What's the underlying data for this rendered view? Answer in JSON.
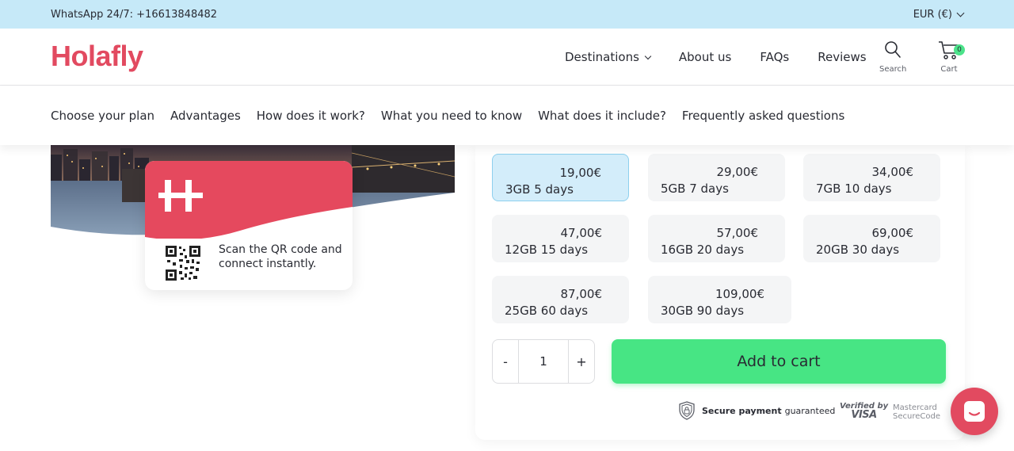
{
  "topbar": {
    "whatsapp": "WhatsApp 24/7: +16613848482",
    "currency": "EUR (€)"
  },
  "header": {
    "logo": "Holafly",
    "nav": [
      "Destinations",
      "About us",
      "FAQs",
      "Reviews"
    ],
    "search_label": "Search",
    "cart_label": "Cart",
    "cart_count": "0"
  },
  "subnav": {
    "items": [
      "Choose your plan",
      "Advantages",
      "How does it work?",
      "What you need to know",
      "What does it include?",
      "Frequently asked questions"
    ]
  },
  "sim_card": {
    "text": "Scan the QR code and connect instantly."
  },
  "plans": [
    {
      "price": "19,00€",
      "name": "3GB 5 days",
      "selected": true
    },
    {
      "price": "29,00€",
      "name": "5GB 7 days",
      "selected": false
    },
    {
      "price": "34,00€",
      "name": "7GB 10 days",
      "selected": false
    },
    {
      "price": "47,00€",
      "name": "12GB 15 days",
      "selected": false
    },
    {
      "price": "57,00€",
      "name": "16GB 20 days",
      "selected": false
    },
    {
      "price": "69,00€",
      "name": "20GB 30 days",
      "selected": false
    },
    {
      "price": "87,00€",
      "name": "25GB 60 days",
      "selected": false
    },
    {
      "price": "109,00€",
      "name": "30GB 90 days",
      "selected": false
    }
  ],
  "quantity": {
    "minus": "-",
    "value": "1",
    "plus": "+"
  },
  "add_to_cart": "Add to cart",
  "security": {
    "secure_bold": "Secure payment",
    "secure_rest": "guaranteed",
    "visa_line1": "Verified by",
    "visa_line2": "VISA",
    "mc_line1": "Mastercard",
    "mc_line2": "SecureCode"
  },
  "colors": {
    "brand": "#e24a60",
    "accent_green": "#47e584",
    "selected_plan": "#d3edfa",
    "topbar": "#c6e9f8"
  }
}
